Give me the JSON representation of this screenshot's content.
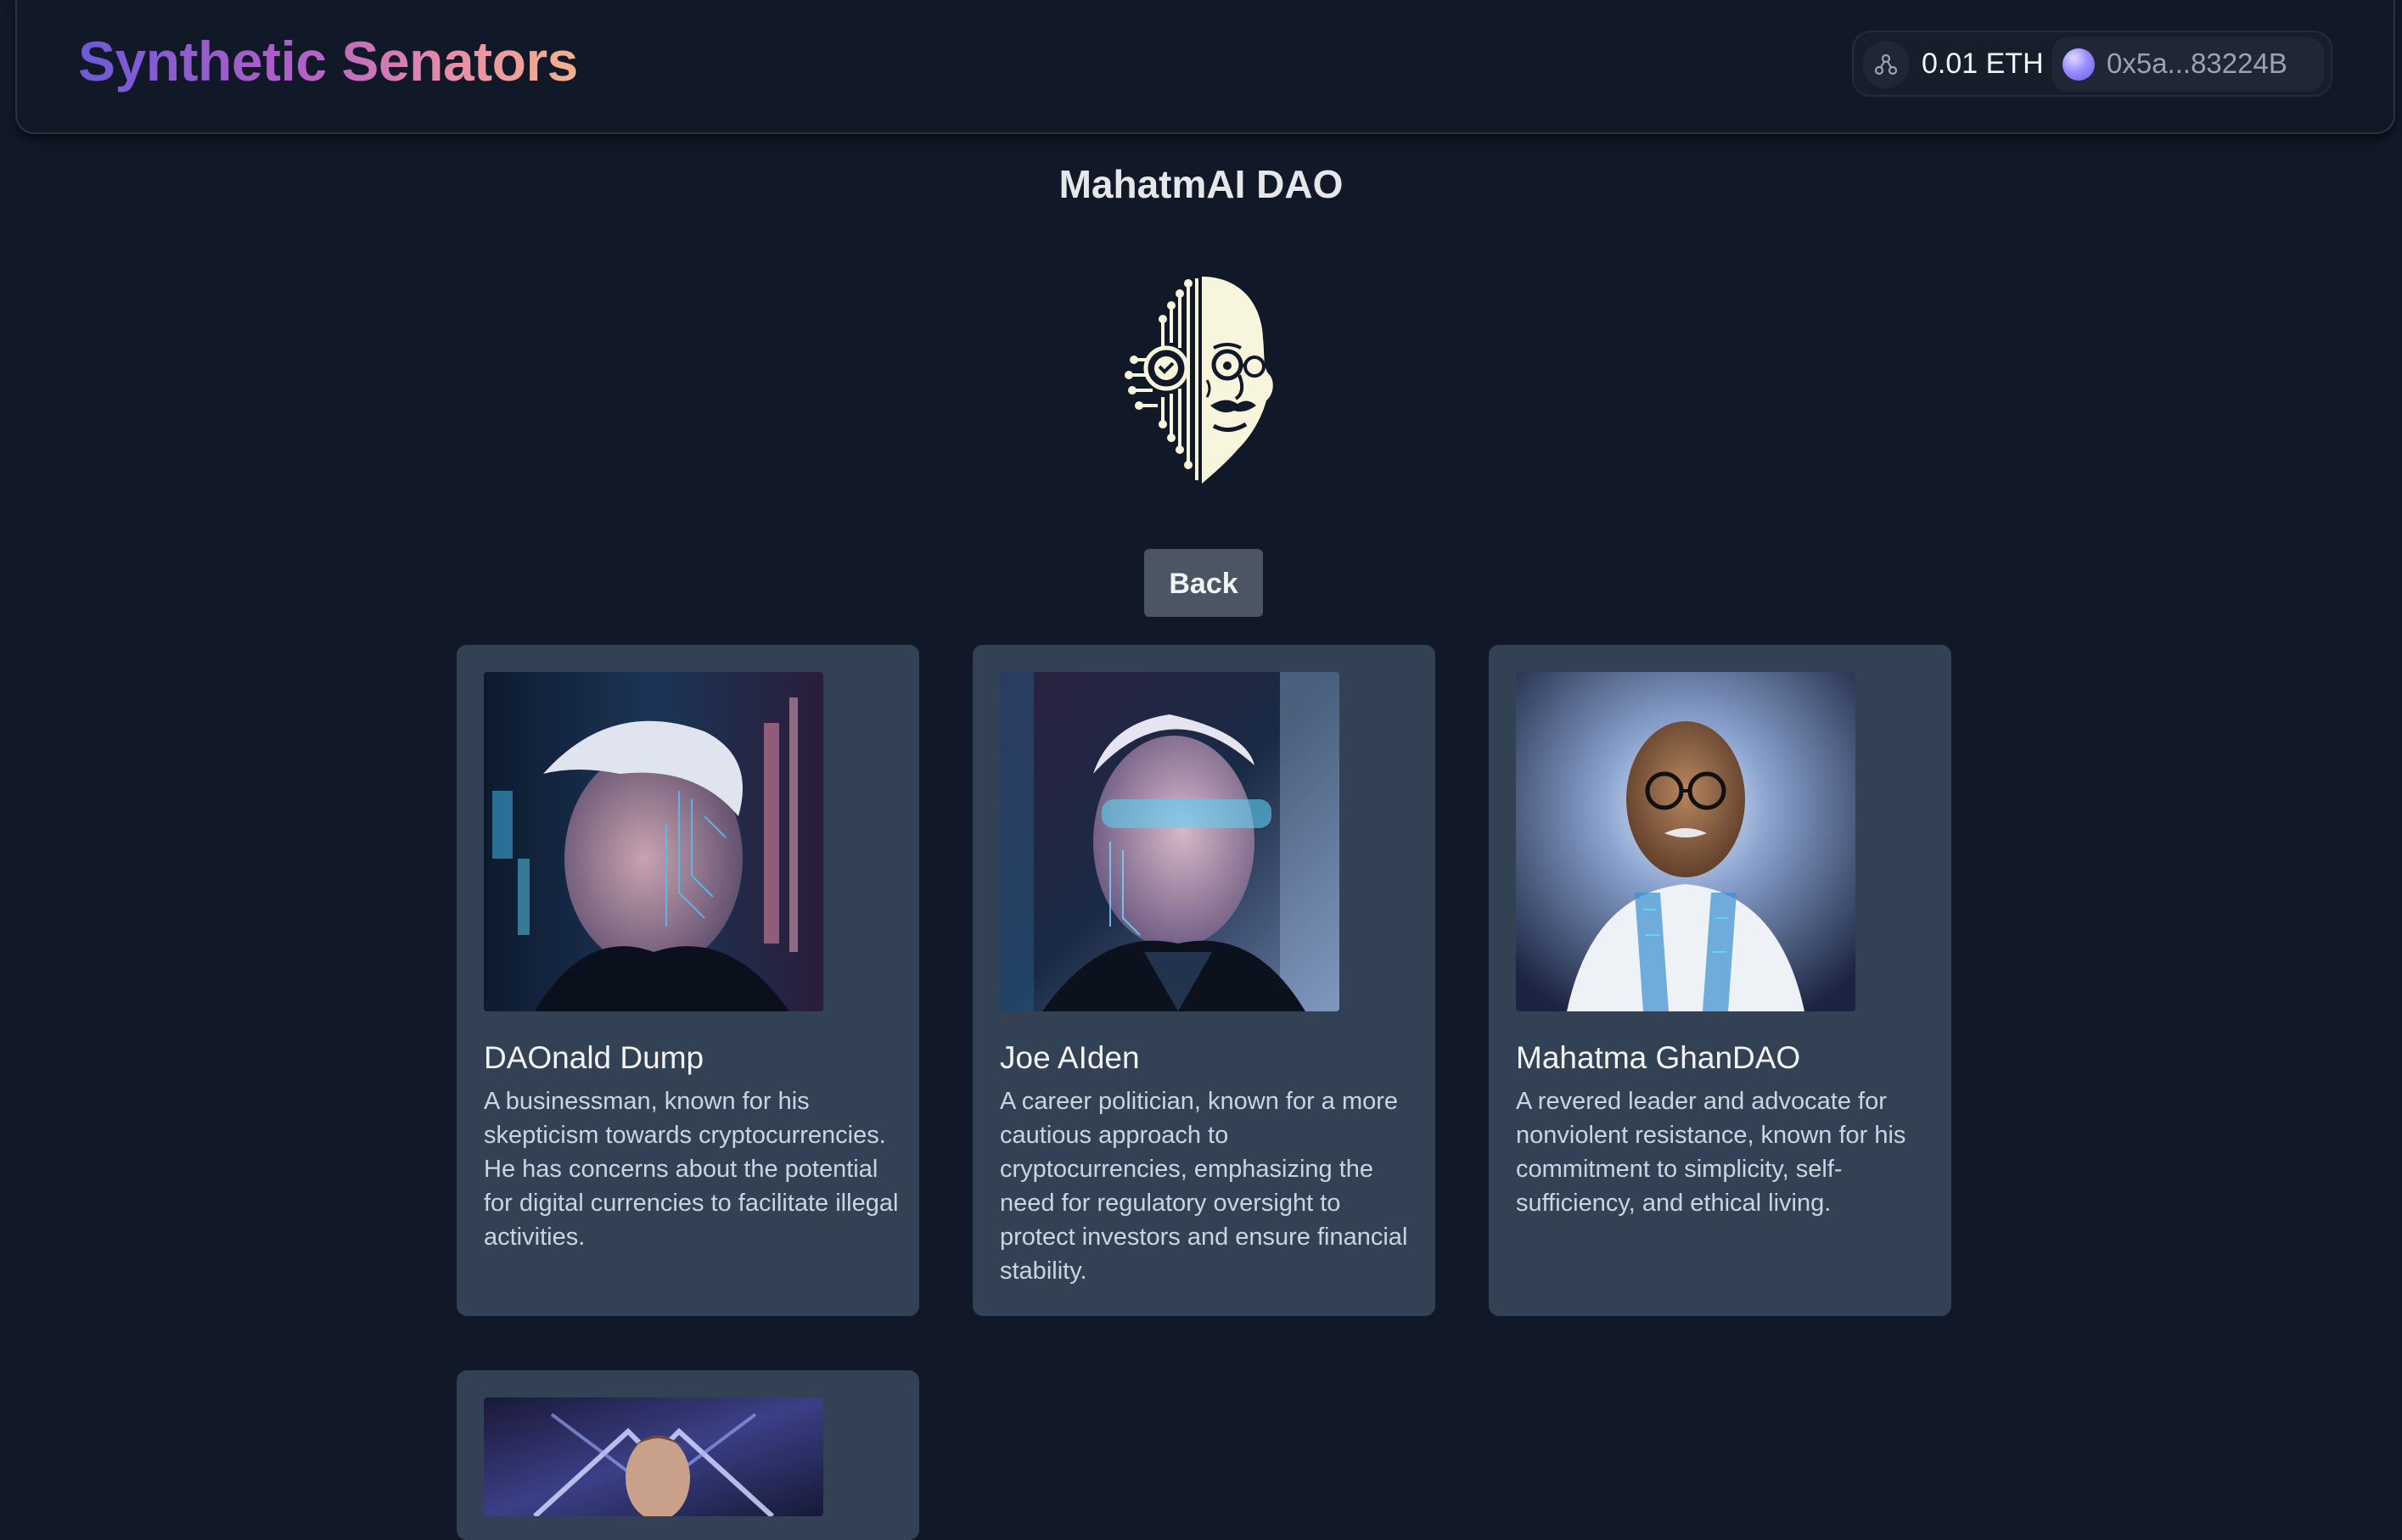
{
  "header": {
    "brand": "Synthetic Senators",
    "network_icon": "network-nodes-icon",
    "balance": "0.01 ETH",
    "address": "0x5a...83224B"
  },
  "main": {
    "title": "MahatmAI DAO",
    "logo_icon": "cyber-gandhi-logo",
    "back_label": "Back",
    "senators": [
      {
        "name": "DAOnald Dump",
        "description": "A businessman, known for his skepticism towards cryptocurrencies. He has concerns about the potential for digital currencies to facilitate illegal activities."
      },
      {
        "name": "Joe AIden",
        "description": "A career politician, known for a more cautious approach to cryptocurrencies, emphasizing the need for regulatory oversight to protect investors and ensure financial stability."
      },
      {
        "name": "Mahatma GhanDAO",
        "description": "A revered leader and advocate for nonviolent resistance, known for his commitment to simplicity, self-sufficiency, and ethical living."
      },
      {
        "name": "",
        "description": ""
      }
    ]
  },
  "colors": {
    "background": "#111827",
    "card": "#334155",
    "button": "#4b5563",
    "brand_gradient_start": "#6d5ad8",
    "brand_gradient_end": "#f3b28a"
  }
}
